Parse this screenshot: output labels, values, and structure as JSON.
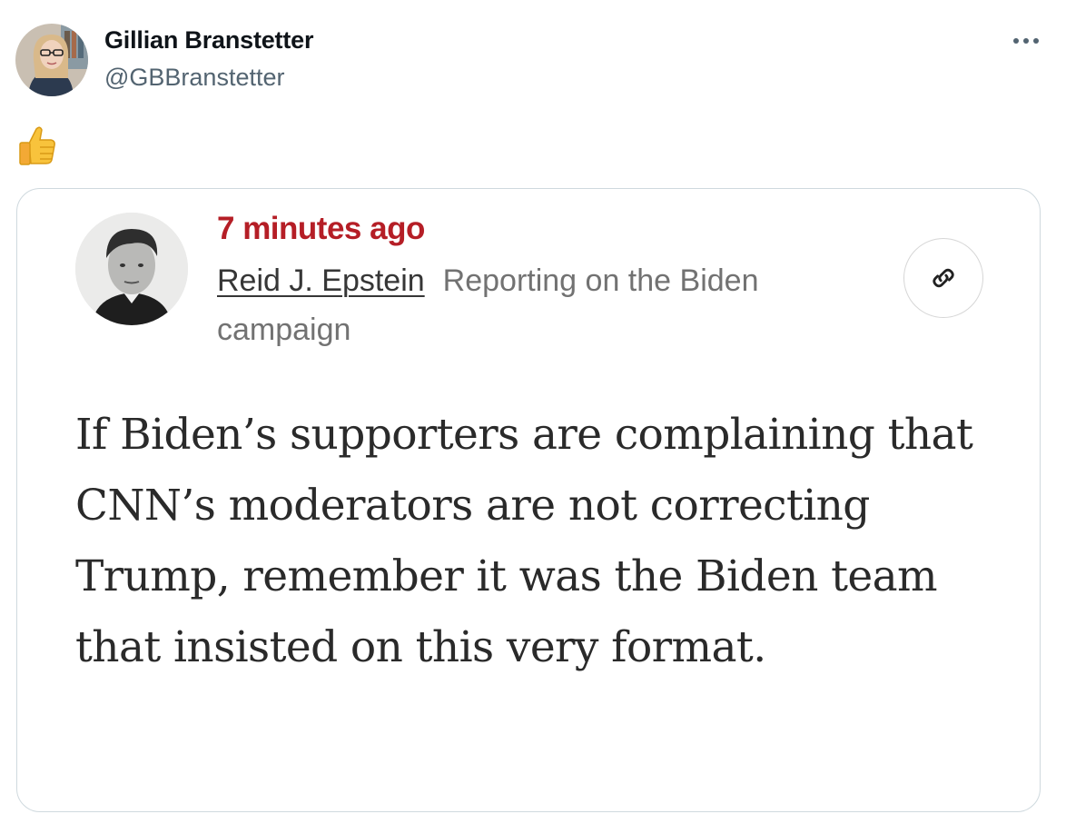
{
  "tweet": {
    "author_name": "Gillian Branstetter",
    "author_handle": "@GBBranstetter",
    "avatar_icon": "profile-photo",
    "more_icon": "more-horizontal-icon",
    "emoji": "👍",
    "emoji_icon": "thumbs-up-icon"
  },
  "card": {
    "timestamp": "7 minutes ago",
    "byline_author": "Reid J. Epstein",
    "byline_role": "Reporting on the Biden campaign",
    "avatar_icon": "reporter-headshot",
    "link_icon": "link-icon",
    "body": "If Biden’s supporters are complaining that CNN’s moderators are not correcting Trump, remember it was the Biden team that insisted on this very format.",
    "colors": {
      "timestamp": "#b51e26",
      "border": "#cfd9de",
      "body_text": "#2a2a2a"
    }
  }
}
